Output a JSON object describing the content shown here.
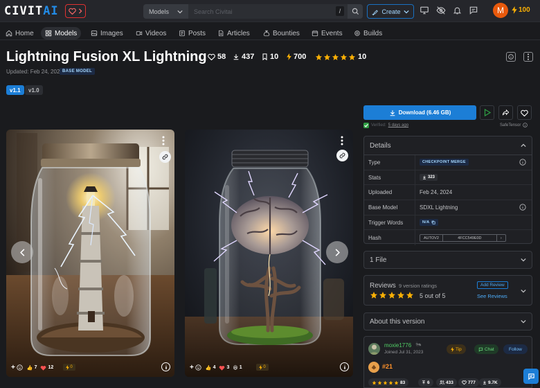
{
  "header": {
    "logo_main": "CIVIT",
    "logo_ai": "AI",
    "model_select": "Models",
    "search_placeholder": "Search Civitai",
    "slash_key": "/",
    "create_label": "Create",
    "avatar_initial": "M",
    "buzz_count": "100"
  },
  "nav": {
    "items": [
      {
        "label": "Home",
        "icon": "home-icon"
      },
      {
        "label": "Models",
        "icon": "layers-icon"
      },
      {
        "label": "Images",
        "icon": "photo-icon"
      },
      {
        "label": "Videos",
        "icon": "video-icon"
      },
      {
        "label": "Posts",
        "icon": "posts-icon"
      },
      {
        "label": "Articles",
        "icon": "article-icon"
      },
      {
        "label": "Bounties",
        "icon": "moneybag-icon"
      },
      {
        "label": "Events",
        "icon": "calendar-icon"
      },
      {
        "label": "Builds",
        "icon": "cpu-icon"
      }
    ],
    "active": "Models"
  },
  "model": {
    "title": "Lightning Fusion XL Lightning",
    "likes": "58",
    "downloads": "437",
    "bookmarks": "10",
    "buzz": "700",
    "rating_count": "10",
    "updated": "Updated: Feb 24, 2024",
    "badge": "BASE MODEL",
    "versions": [
      "v1.1",
      "v1.0"
    ],
    "active_version": "v1.1"
  },
  "gallery": {
    "cards": [
      {
        "reactions": {
          "likes": "7",
          "hearts": "12",
          "buzz": "0"
        }
      },
      {
        "reactions": {
          "likes": "4",
          "hearts": "3",
          "laugh": "1",
          "buzz": "0"
        }
      }
    ]
  },
  "download": {
    "label": "Download (6.46 GB)",
    "verified_label": "Verified:",
    "verified_when": "5 days ago",
    "format": "SafeTensor"
  },
  "details": {
    "heading": "Details",
    "rows": {
      "type_label": "Type",
      "type_value": "CHECKPOINT MERGE",
      "stats_label": "Stats",
      "stats_value": "323",
      "uploaded_label": "Uploaded",
      "uploaded_value": "Feb 24, 2024",
      "base_label": "Base Model",
      "base_value": "SDXL Lightning",
      "trigger_label": "Trigger Words",
      "trigger_value": "N/A",
      "hash_label": "Hash",
      "hash_type": "AUTOV2",
      "hash_value": "4FCC549E0D"
    }
  },
  "files": {
    "label": "1 File"
  },
  "reviews": {
    "heading": "Reviews",
    "count_text": "9 version ratings",
    "score_text": "5 out of 5",
    "add_label": "Add Review",
    "see_label": "See Reviews"
  },
  "about": {
    "label": "About this version"
  },
  "creator": {
    "name": "moxie1776",
    "joined": "Joined Jul 31, 2023",
    "tip_label": "Tip",
    "chat_label": "Chat",
    "follow_label": "Follow",
    "rank": "#21",
    "stats": {
      "rating": "83",
      "uploads": "6",
      "followers": "433",
      "likes": "777",
      "downloads": "9.7K"
    }
  },
  "colors": {
    "accent": "#1c7ed6",
    "star": "#fab005",
    "heart": "#fa5252",
    "bg": "#1a1b1e"
  }
}
